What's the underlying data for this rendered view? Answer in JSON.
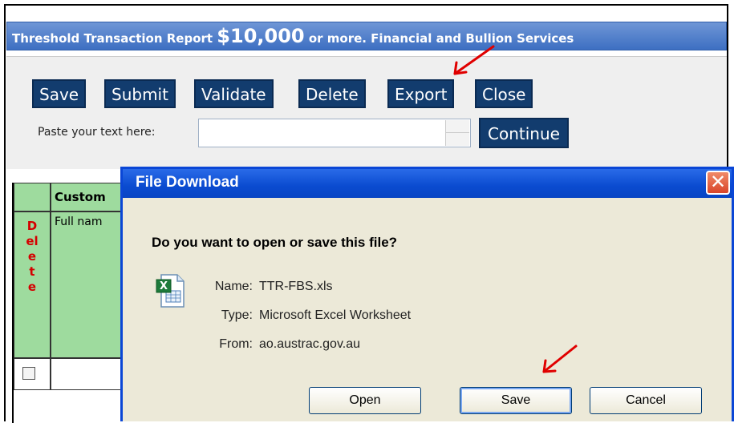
{
  "report": {
    "title_prefix": "Threshold Transaction Report ",
    "title_amount": "$10,000",
    "title_suffix": " or more. Financial and Bullion Services"
  },
  "toolbar": {
    "buttons": [
      "Save",
      "Submit",
      "Validate",
      "Delete",
      "Export",
      "Close"
    ],
    "paste_label": "Paste your text here:",
    "paste_value": "",
    "continue_label": "Continue"
  },
  "grid": {
    "header_label": "Custom",
    "delete_label": "Delete",
    "full_name_label": "Full nam"
  },
  "dialog": {
    "title": "File Download",
    "close_glyph": "✕",
    "question": "Do you want to open or save this file?",
    "file": {
      "name_label": "Name:",
      "name_value": "TTR-FBS.xls",
      "type_label": "Type:",
      "type_value": "Microsoft Excel Worksheet",
      "from_label": "From:",
      "from_value": "ao.austrac.gov.au"
    },
    "buttons": {
      "open": "Open",
      "save": "Save",
      "cancel": "Cancel"
    }
  },
  "icons": {
    "file_icon": "excel-file-icon",
    "annotation_arrow": "red-arrow-icon"
  },
  "colors": {
    "title_bar": "#3d6fc2",
    "button_navy": "#123c6e",
    "grid_green": "#9edb9e",
    "delete_red": "#d40000",
    "dialog_blue": "#0a4bd0",
    "arrow_red": "#e00000"
  }
}
